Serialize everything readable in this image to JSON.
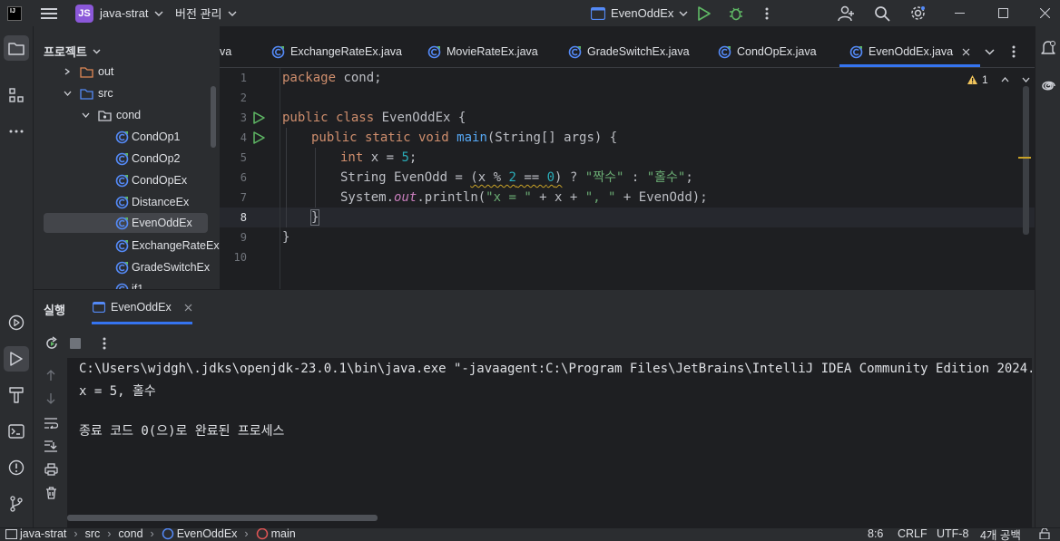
{
  "titlebar": {
    "app_logo_text": "IJ",
    "project_badge": "JS",
    "project_name": "java-strat",
    "vcs_label": "버전 관리",
    "run_config": "EvenOddEx"
  },
  "project_panel": {
    "title": "프로젝트",
    "items": [
      {
        "label": "out",
        "kind": "folder"
      },
      {
        "label": "src",
        "kind": "folder"
      },
      {
        "label": "cond",
        "kind": "package"
      },
      {
        "label": "CondOp1",
        "kind": "class"
      },
      {
        "label": "CondOp2",
        "kind": "class"
      },
      {
        "label": "CondOpEx",
        "kind": "class"
      },
      {
        "label": "DistanceEx",
        "kind": "class"
      },
      {
        "label": "EvenOddEx",
        "kind": "class",
        "selected": true
      },
      {
        "label": "ExchangeRateEx",
        "kind": "class"
      },
      {
        "label": "GradeSwitchEx",
        "kind": "class"
      },
      {
        "label": "if1",
        "kind": "class"
      }
    ]
  },
  "tabs": [
    {
      "label": "va",
      "partial": true
    },
    {
      "label": "ExchangeRateEx.java"
    },
    {
      "label": "MovieRateEx.java"
    },
    {
      "label": "GradeSwitchEx.java"
    },
    {
      "label": "CondOpEx.java"
    },
    {
      "label": "EvenOddEx.java",
      "active": true
    }
  ],
  "editor": {
    "warning_count": "1",
    "line_numbers": [
      "1",
      "2",
      "3",
      "4",
      "5",
      "6",
      "7",
      "8",
      "9",
      "10"
    ],
    "code": {
      "l1_kw": "package",
      "l1_rest": " cond;",
      "l3_kw": "public class",
      "l3_rest": " EvenOddEx {",
      "l4_kw": "public static void",
      "l4_fn": "main",
      "l4_rest": "(String[] args) {",
      "l5_kw": "int",
      "l5_rest1": " x = ",
      "l5_num": "5",
      "l5_rest2": ";",
      "l6_a": "String EvenOdd = ",
      "l6_cond_a": "(x % ",
      "l6_cond_num1": "2",
      "l6_cond_b": " == ",
      "l6_cond_num2": "0",
      "l6_cond_c": ")",
      "l6_b": " ? ",
      "l6_str1": "\"짝수\"",
      "l6_c": " : ",
      "l6_str2": "\"홀수\"",
      "l6_d": ";",
      "l7_a": "System.",
      "l7_out": "out",
      "l7_b": ".println(",
      "l7_str1": "\"x = \"",
      "l7_c": " + x + ",
      "l7_str2": "\", \"",
      "l7_d": " + EvenOdd);",
      "l8": "}",
      "l9": "}"
    }
  },
  "run_panel": {
    "title": "실행",
    "tab_label": "EvenOddEx",
    "console": [
      "C:\\Users\\wjdgh\\.jdks\\openjdk-23.0.1\\bin\\java.exe \"-javaagent:C:\\Program Files\\JetBrains\\IntelliJ IDEA Community Edition 2024.2.3\\lib",
      "x = 5, 홀수",
      "",
      "종료 코드 0(으)로 완료된 프로세스"
    ]
  },
  "statusbar": {
    "breadcrumb": [
      "java-strat",
      "src",
      "cond",
      "EvenOddEx",
      "main"
    ],
    "position": "8:6",
    "line_ending": "CRLF",
    "encoding": "UTF-8",
    "indent": "4개 공백"
  },
  "colors": {
    "accent": "#3574f0",
    "run_green": "#5fb865",
    "warning": "#f2c55c"
  }
}
